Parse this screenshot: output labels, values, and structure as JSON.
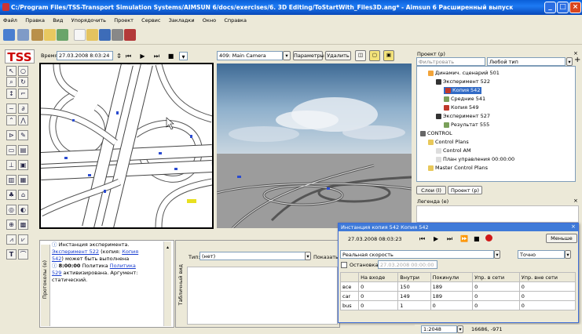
{
  "window": {
    "title": "C:/Program Files/TSS-Transport Simulation Systems/AIMSUN 6/docs/exercises/6. 3D Editing/ToStartWith_Files3D.ang* - Aimsun 6 Расширенный выпуск",
    "minimize": "_",
    "maximize": "□",
    "close": "×"
  },
  "menu": [
    "Файл",
    "Правка",
    "Вид",
    "Упорядочить",
    "Проект",
    "Сервис",
    "Закладки",
    "Окно",
    "Справка"
  ],
  "logo": "TSS",
  "view2d": {
    "time_label": "Время",
    "time_value": "27.03.2008 8:03:24"
  },
  "view3d": {
    "camera": "409: Main Camera",
    "params_button": "Параметры",
    "delete_button": "Удалить"
  },
  "project": {
    "title": "Проект (р)",
    "filter_placeholder": "Фильтровать",
    "type_filter": "Любой тип",
    "tree": [
      {
        "label": "Динамич. сценарий 501",
        "level": 1,
        "color": "#f2a43a",
        "selected": false
      },
      {
        "label": "Эксперимент 522",
        "level": 2,
        "color": "#333333",
        "selected": false
      },
      {
        "label": "Копия 542",
        "level": 3,
        "color": "#c0392b",
        "selected": true
      },
      {
        "label": "Средние 541",
        "level": 3,
        "color": "#7aa05a",
        "selected": false
      },
      {
        "label": "Копия 549",
        "level": 3,
        "color": "#c0392b",
        "selected": false
      },
      {
        "label": "Эксперимент 527",
        "level": 2,
        "color": "#333333",
        "selected": false
      },
      {
        "label": "Результат 555",
        "level": 3,
        "color": "#7aa05a",
        "selected": false
      },
      {
        "label": "CONTROL",
        "level": 0,
        "color": "#666666",
        "selected": false
      },
      {
        "label": "Control Plans",
        "level": 1,
        "color": "#e8c85a",
        "selected": false
      },
      {
        "label": "Control AM",
        "level": 2,
        "color": "#dddddd",
        "selected": false
      },
      {
        "label": "План управления 00:00:00",
        "level": 2,
        "color": "#dddddd",
        "selected": false
      },
      {
        "label": "Master Control Plans",
        "level": 1,
        "color": "#e8c85a",
        "selected": false
      }
    ],
    "tabs": [
      "Слои (l)",
      "Проект (р)"
    ]
  },
  "legend": {
    "title": "Легенда (е)"
  },
  "messages": {
    "side_label": "Протоколы (о)",
    "lines": [
      {
        "kind": "info",
        "parts": [
          {
            "t": "Инстанция эксперимента.",
            "link": false
          }
        ]
      },
      {
        "kind": "link",
        "parts": [
          {
            "t": "Эксперимент 522",
            "link": true
          },
          {
            "t": " (копия: ",
            "link": false
          },
          {
            "t": "Копия",
            "link": true
          }
        ]
      },
      {
        "kind": "link",
        "parts": [
          {
            "t": "542",
            "link": true
          },
          {
            "t": ") может быть выполнена",
            "link": false
          }
        ]
      },
      {
        "kind": "time",
        "parts": [
          {
            "t": "8:00:00",
            "link": false
          },
          {
            "t": " Политика ",
            "link": false
          },
          {
            "t": "Политика",
            "link": true
          }
        ]
      },
      {
        "kind": "text",
        "parts": [
          {
            "t": "529",
            "link": true
          },
          {
            "t": " активизирована. Аргумент:",
            "link": false
          }
        ]
      },
      {
        "kind": "text",
        "parts": [
          {
            "t": "статический.",
            "link": false
          }
        ]
      }
    ]
  },
  "table_panel": {
    "side_label": "Табличный вид",
    "type_label": "Тип:",
    "type_value": "(нет)",
    "show_label": "Показать"
  },
  "dialog": {
    "title": "Инстанция копия 542 Копия 542",
    "time": "27.03.2008 08:03:23",
    "less_button": "Меньше",
    "speed_label": "Реальная скорость",
    "accuracy": "Точно",
    "stop_label": "Остановка:",
    "stop_value": "27.03.2008 00:00:00",
    "columns": [
      "",
      "На входе",
      "Внутри",
      "Покинули",
      "Упр. в сети",
      "Упр. вне сети"
    ],
    "rows": [
      [
        "все",
        "0",
        "150",
        "189",
        "0",
        "0"
      ],
      [
        "car",
        "0",
        "149",
        "189",
        "0",
        "0"
      ],
      [
        "bus",
        "0",
        "1",
        "0",
        "0",
        "0"
      ]
    ]
  },
  "status": {
    "zoom": "1:2048",
    "coords": "16686, -971"
  }
}
